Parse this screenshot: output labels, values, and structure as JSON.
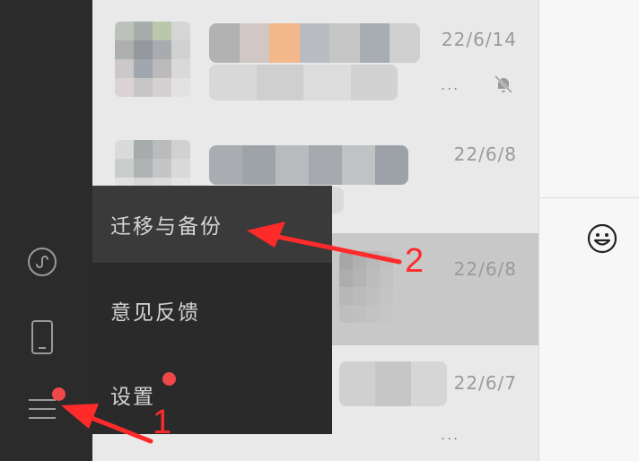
{
  "chats": [
    {
      "date": "22/6/14",
      "muted": true,
      "preview_ellipsis": "..."
    },
    {
      "date": "22/6/8",
      "muted": false,
      "preview_ellipsis": ""
    },
    {
      "date": "22/6/8",
      "muted": false,
      "preview_ellipsis": "",
      "selected": true
    },
    {
      "date": "22/6/7",
      "muted": false,
      "preview_ellipsis": "..."
    }
  ],
  "menu": {
    "items": [
      {
        "label": "迁移与备份",
        "hover": true,
        "badge": false
      },
      {
        "label": "意见反馈",
        "hover": false,
        "badge": false
      },
      {
        "label": "设置",
        "hover": false,
        "badge": true
      }
    ]
  },
  "annotations": {
    "step1": "1",
    "step2": "2"
  },
  "icons": {
    "mini_program": "mini-program-icon",
    "phone": "phone-icon",
    "menu": "hamburger-menu-icon",
    "emoji": "emoji-icon",
    "mute": "mute-bell-icon"
  },
  "colors": {
    "sidebar": "#2b2b2b",
    "popup": "#2a2a2a",
    "badge": "#f04848",
    "annotation": "#ff2a2a",
    "list_bg": "#e9e9e9",
    "selected_row": "#c8c8c8"
  }
}
